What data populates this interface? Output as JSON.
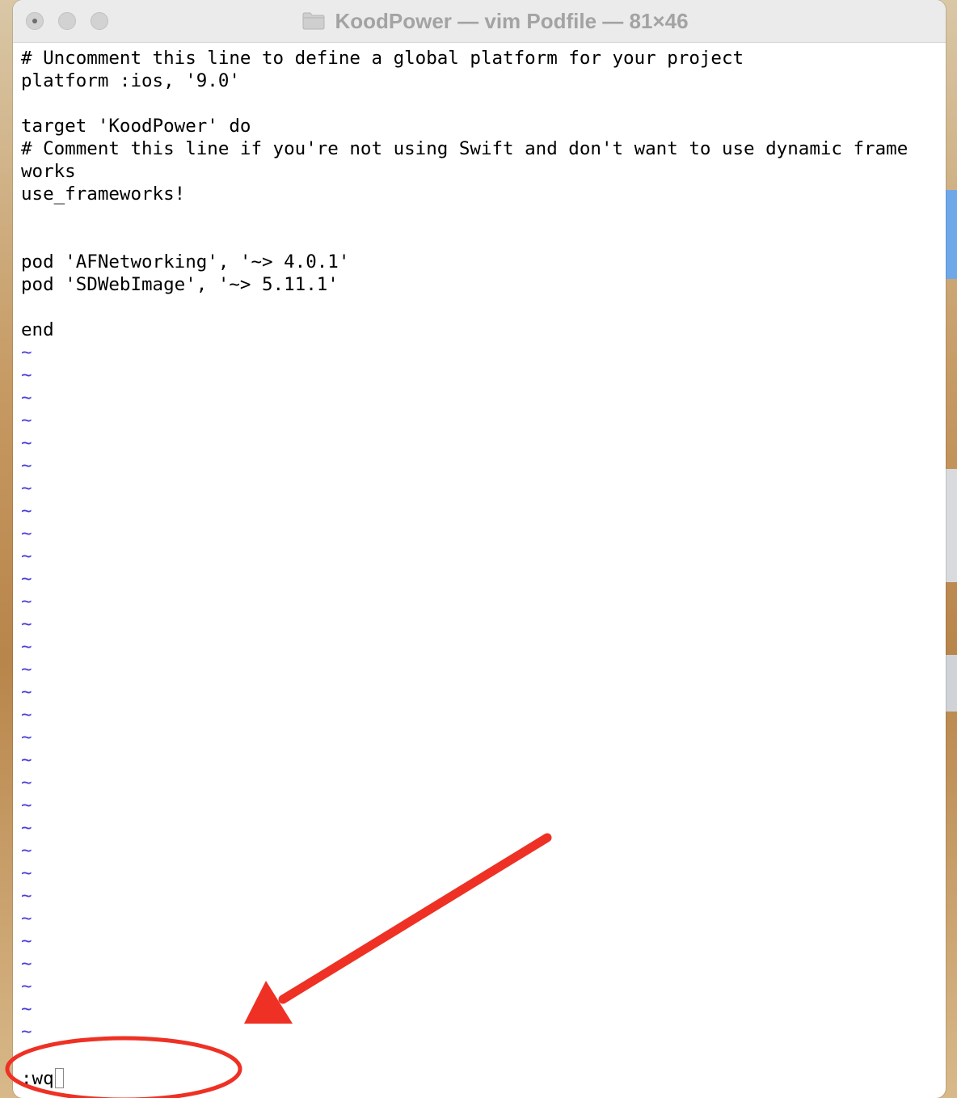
{
  "window": {
    "title": "KoodPower — vim Podfile — 81×46"
  },
  "editor": {
    "lines": [
      "# Uncomment this line to define a global platform for your project",
      "platform :ios, '9.0'",
      "",
      "target 'KoodPower' do",
      "# Comment this line if you're not using Swift and don't want to use dynamic frame",
      "works",
      "use_frameworks!",
      "",
      "",
      "pod 'AFNetworking', '~> 4.0.1'",
      "pod 'SDWebImage', '~> 5.11.1'",
      "",
      "end"
    ],
    "tilde_marker": "~",
    "tilde_count": 31
  },
  "command_line": {
    "text": ":wq"
  },
  "colors": {
    "tilde": "#4a3fd8",
    "annotation": "#ee3124",
    "background_text": "#000000"
  }
}
